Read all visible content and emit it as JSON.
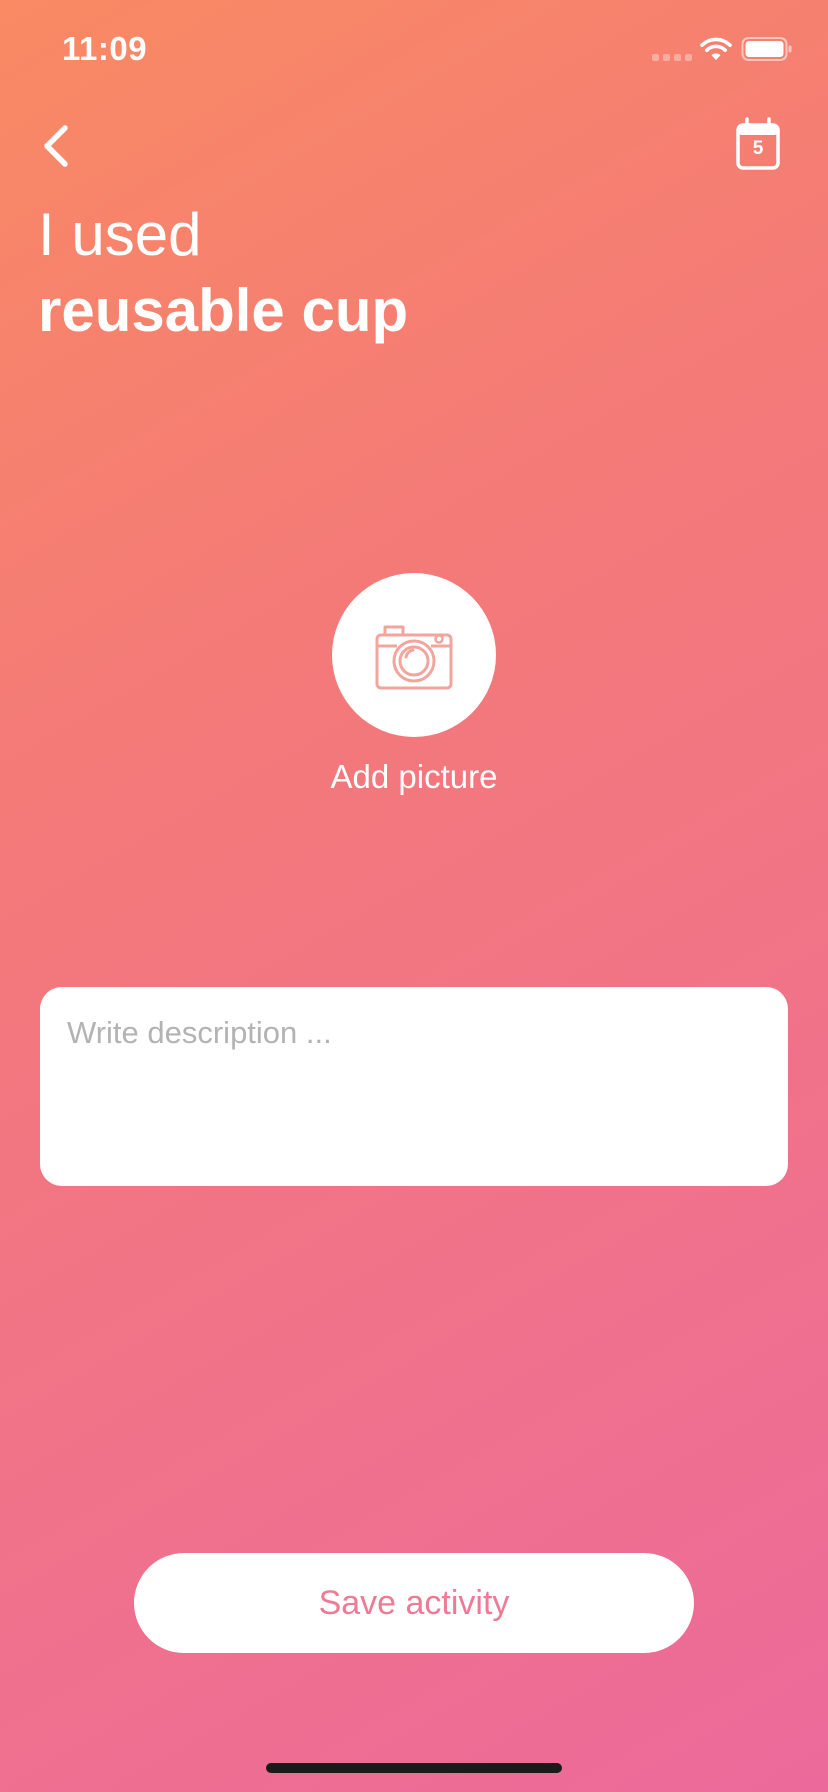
{
  "status_bar": {
    "time": "11:09"
  },
  "nav": {
    "back_icon": "chevron-left-icon",
    "calendar_icon": "calendar-icon",
    "calendar_day": "5"
  },
  "title": {
    "prefix": "I used",
    "activity": "reusable cup"
  },
  "picture": {
    "icon": "camera-icon",
    "label": "Add picture"
  },
  "description": {
    "placeholder": "Write description ...",
    "value": ""
  },
  "actions": {
    "save_label": "Save activity"
  },
  "colors": {
    "gradient_start": "#f98a63",
    "gradient_end": "#ec6a9b",
    "accent": "#ef7a95",
    "camera_stroke": "#f3a49c"
  }
}
